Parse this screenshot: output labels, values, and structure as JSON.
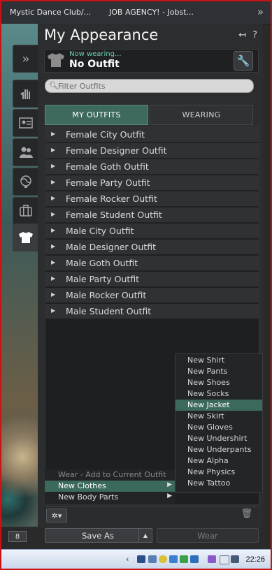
{
  "top_tabs": [
    "Mystic  Dance Club/...",
    "JOB AGENCY! - Jobst..."
  ],
  "panel": {
    "title": "My Appearance",
    "now_wearing_label": "Now wearing...",
    "current_outfit": "No Outfit",
    "filter_placeholder": "Filter Outfits"
  },
  "tabs": [
    {
      "label": "MY OUTFITS",
      "selected": true
    },
    {
      "label": "WEARING",
      "selected": false
    }
  ],
  "outfits": [
    "Female City Outfit",
    "Female Designer Outfit",
    "Female Goth Outfit",
    "Female Party Outfit",
    "Female Rocker Outfit",
    "Female Student Outfit",
    "Male City Outfit",
    "Male Designer Outfit",
    "Male Goth Outfit",
    "Male Party Outfit",
    "Male Rocker Outfit",
    "Male Student Outfit"
  ],
  "gear_menu": [
    {
      "label": "Wear - Add to Current Outfit",
      "state": "disabled"
    },
    {
      "label": "New Clothes",
      "state": "highlighted",
      "submenu": true
    },
    {
      "label": "New Body Parts",
      "state": "normal",
      "submenu": true
    }
  ],
  "new_clothes_menu": [
    "New Shirt",
    "New Pants",
    "New Shoes",
    "New Socks",
    "New Jacket",
    "New Skirt",
    "New Gloves",
    "New Undershirt",
    "New Underpants",
    "New Alpha",
    "New Physics",
    "New Tattoo"
  ],
  "new_clothes_highlight": "New Jacket",
  "buttons": {
    "save_as": "Save As",
    "wear": "Wear"
  },
  "badge": "8",
  "clock": "22:26",
  "colors": {
    "accent": "#3e6a5d",
    "now_wearing": "#6ecfb0",
    "frame": "#c81414"
  }
}
